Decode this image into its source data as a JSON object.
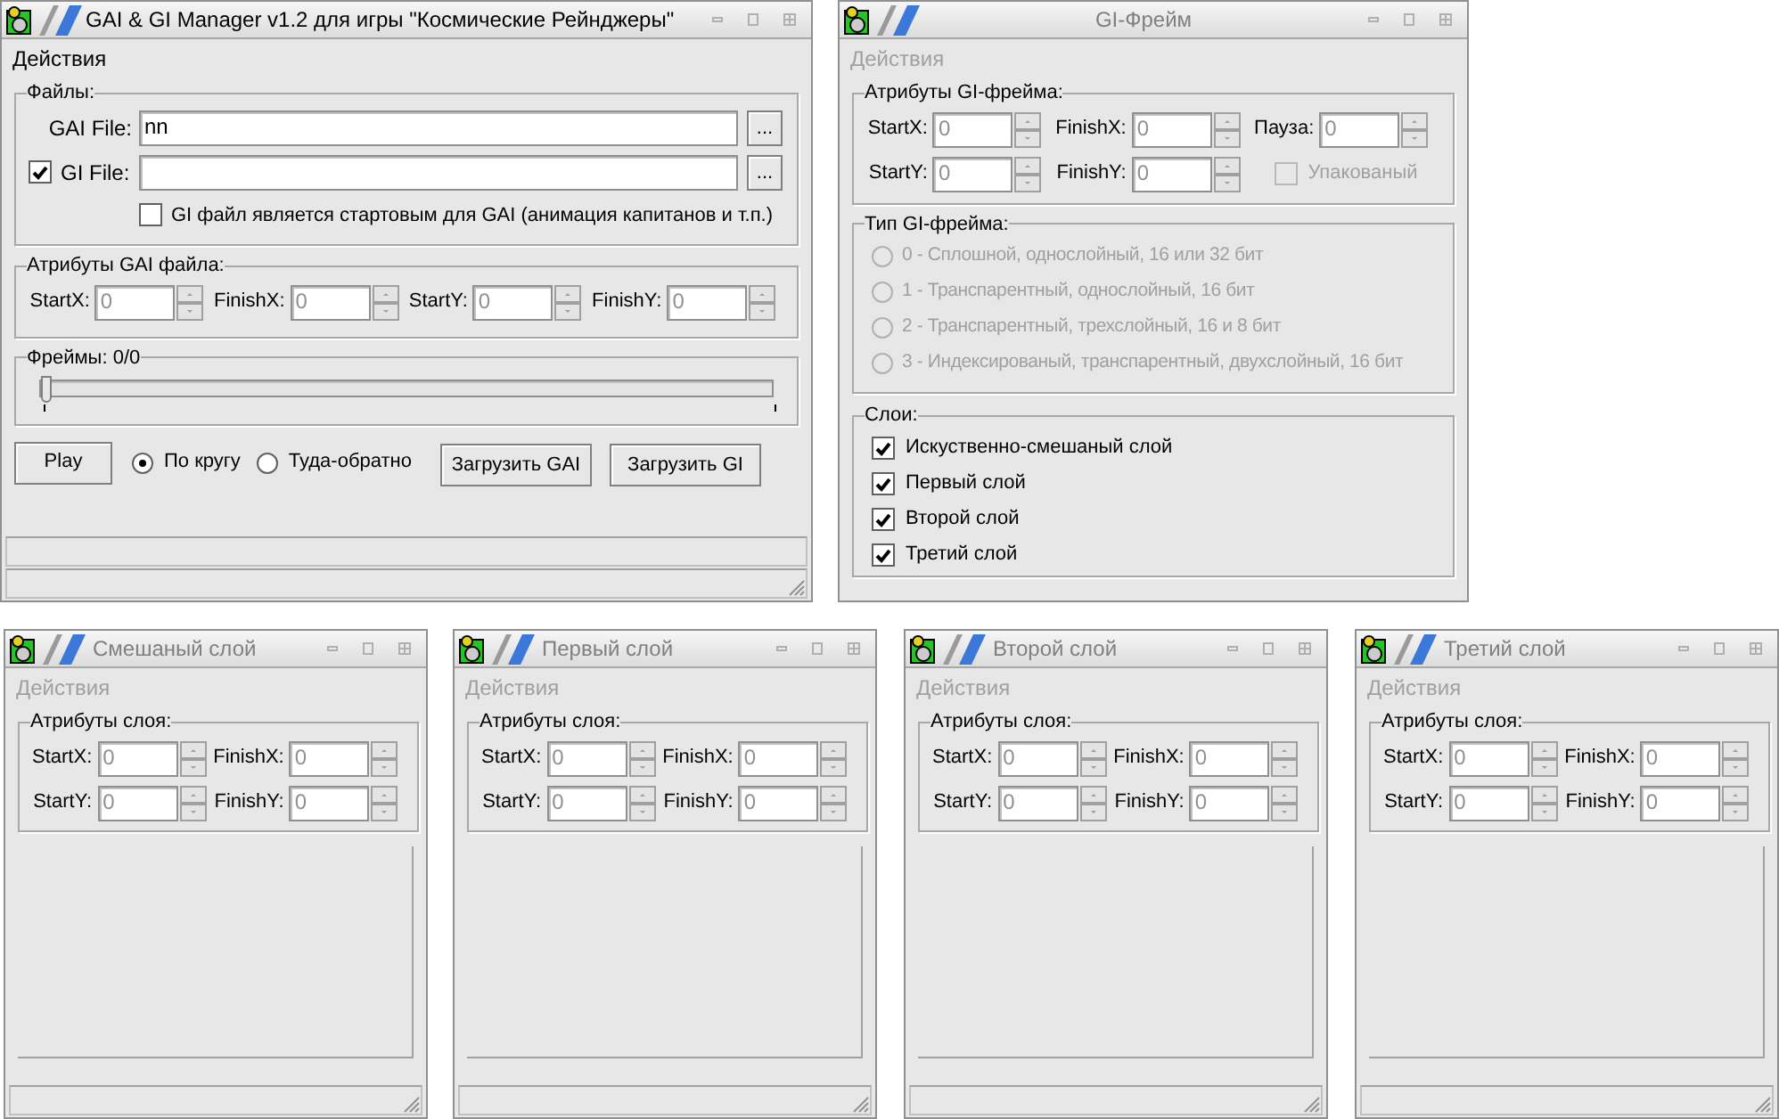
{
  "main_window": {
    "title": "GAI & GI Manager v1.2 для игры \"Космические Рейнджеры\"",
    "active": true,
    "menu": [
      {
        "label": "Действия",
        "disabled": false
      }
    ],
    "files": {
      "label": "Файлы:",
      "gai_file": {
        "label": "GAI File:",
        "value": "nn",
        "browse": "..."
      },
      "gi_file": {
        "label": "GI File:",
        "checked": true,
        "browse": "..."
      },
      "start_option": {
        "label": "GI файл является стартовым для GAI (анимация капитанов и т.п.)",
        "checked": false
      }
    },
    "gai_attributes": {
      "label": "Атрибуты GAI файла:",
      "rows": [
        [
          {
            "label": "StartX:",
            "value": "0",
            "disabled": true
          },
          {
            "label": "FinishX:",
            "value": "0",
            "disabled": true
          },
          {
            "label": "StartY:",
            "value": "0",
            "disabled": true
          },
          {
            "label": "FinishY:",
            "value": "0",
            "disabled": true
          }
        ]
      ]
    },
    "frames": {
      "label": "Фреймы: 0/0",
      "level": 0
    },
    "play_button": "Play",
    "loop_modes": [
      {
        "label": "По кругу",
        "selected": true
      },
      {
        "label": "Туда-обратно",
        "selected": false
      }
    ],
    "load_buttons": [
      "Загрузить GAI",
      "Загрузить GI"
    ]
  },
  "gi_frame_window": {
    "title": "GI-Фрейм",
    "active": false,
    "menu": [
      {
        "label": "Действия",
        "disabled": true
      }
    ],
    "attributes": {
      "label": "Атрибуты GI-фрейма:",
      "rows": [
        [
          {
            "label": "StartX:",
            "value": "0",
            "disabled": true
          },
          {
            "label": "FinishX:",
            "value": "0",
            "disabled": true
          },
          {
            "label": "Пауза:",
            "value": "0",
            "disabled": true
          }
        ],
        [
          {
            "label": "StartY:",
            "value": "0",
            "disabled": true
          },
          {
            "label": "FinishY:",
            "value": "0",
            "disabled": true
          }
        ]
      ],
      "packed": {
        "label": "Упакованый",
        "checked": false,
        "disabled": true
      }
    },
    "frame_type": {
      "label": "Тип GI-фрейма:",
      "options": [
        {
          "label": "0 - Сплошной, однослойный, 16 или 32 бит",
          "selected": false,
          "disabled": true
        },
        {
          "label": "1 - Транспарентный, однослойный, 16 бит",
          "selected": false,
          "disabled": true
        },
        {
          "label": "2 - Транспарентный, трехслойный, 16 и 8 бит",
          "selected": false,
          "disabled": true
        },
        {
          "label": "3 - Индексированый, транспарентный, двухслойный, 16 бит",
          "selected": false,
          "disabled": true
        }
      ]
    },
    "layers": {
      "label": "Слои:",
      "items": [
        {
          "label": "Искуственно-смешаный слой",
          "checked": true
        },
        {
          "label": "Первый слой",
          "checked": true
        },
        {
          "label": "Второй слой",
          "checked": true
        },
        {
          "label": "Третий слой",
          "checked": true
        }
      ]
    }
  },
  "layer_windows": [
    {
      "title": "Смешаный слой",
      "active": false,
      "menu": [
        {
          "label": "Действия",
          "disabled": true
        }
      ],
      "attributes": {
        "label": "Атрибуты слоя:",
        "rows": [
          [
            {
              "label": "StartX:",
              "value": "0",
              "disabled": true
            },
            {
              "label": "FinishX:",
              "value": "0",
              "disabled": true
            }
          ],
          [
            {
              "label": "StartY:",
              "value": "0",
              "disabled": true
            },
            {
              "label": "FinishY:",
              "value": "0",
              "disabled": true
            }
          ]
        ]
      }
    },
    {
      "title": "Первый слой",
      "active": false,
      "menu": [
        {
          "label": "Действия",
          "disabled": true
        }
      ],
      "attributes": {
        "label": "Атрибуты слоя:",
        "rows": [
          [
            {
              "label": "StartX:",
              "value": "0",
              "disabled": true
            },
            {
              "label": "FinishX:",
              "value": "0",
              "disabled": true
            }
          ],
          [
            {
              "label": "StartY:",
              "value": "0",
              "disabled": true
            },
            {
              "label": "FinishY:",
              "value": "0",
              "disabled": true
            }
          ]
        ]
      }
    },
    {
      "title": "Второй слой",
      "active": false,
      "menu": [
        {
          "label": "Действия",
          "disabled": true
        }
      ],
      "attributes": {
        "label": "Атрибуты слоя:",
        "rows": [
          [
            {
              "label": "StartX:",
              "value": "0",
              "disabled": true
            },
            {
              "label": "FinishX:",
              "value": "0",
              "disabled": true
            }
          ],
          [
            {
              "label": "StartY:",
              "value": "0",
              "disabled": true
            },
            {
              "label": "FinishY:",
              "value": "0",
              "disabled": true
            }
          ]
        ]
      }
    },
    {
      "title": "Третий слой",
      "active": false,
      "menu": [
        {
          "label": "Действия",
          "disabled": true
        }
      ],
      "attributes": {
        "label": "Атрибуты слоя:",
        "rows": [
          [
            {
              "label": "StartX:",
              "value": "0",
              "disabled": true
            },
            {
              "label": "FinishX:",
              "value": "0",
              "disabled": true
            }
          ],
          [
            {
              "label": "StartY:",
              "value": "0",
              "disabled": true
            },
            {
              "label": "FinishY:",
              "value": "0",
              "disabled": true
            }
          ]
        ]
      }
    }
  ]
}
